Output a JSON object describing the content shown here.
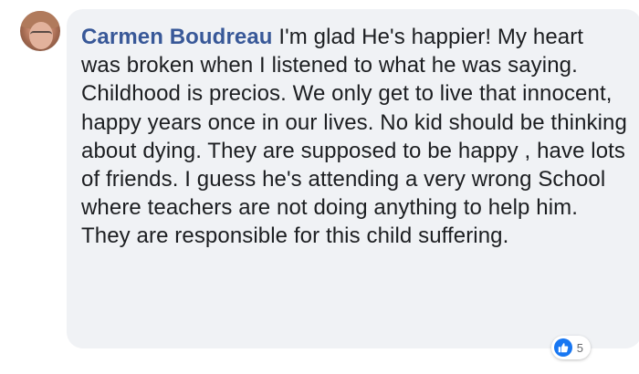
{
  "comment": {
    "author": "Carmen Boudreau",
    "text": "I'm glad He's happier! My heart was broken when I listened to what he was saying. Childhood is precios. We only get to live that innocent, happy years once in our lives. No kid should be thinking about dying. They are supposed to be happy , have lots of friends. I guess he's attending a very wrong School where teachers are not doing anything to help him. They are responsible for this child suffering.",
    "reaction_icon": "like-icon",
    "reaction_count": "5"
  },
  "colors": {
    "author": "#385898",
    "bubble_bg": "#f0f2f5",
    "text": "#1c1e21",
    "like": "#1877f2"
  }
}
